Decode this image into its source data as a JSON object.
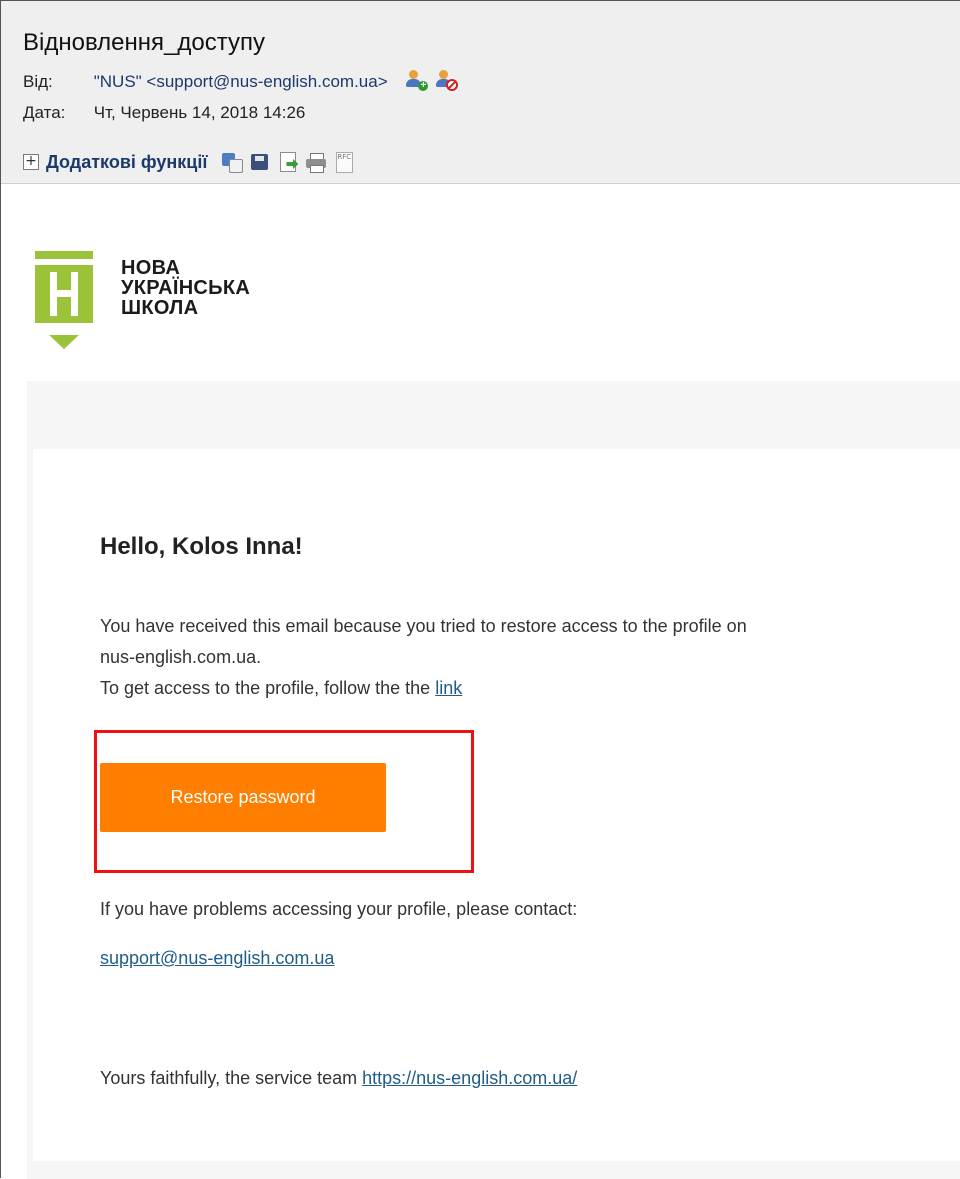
{
  "header": {
    "subject": "Відновлення_доступу",
    "from_label": "Від:",
    "from_value": "\"NUS\" <support@nus-english.com.ua>",
    "date_label": "Дата:",
    "date_value": "Чт, Червень 14, 2018 14:26",
    "contact_icons": [
      "add-contact-icon",
      "block-contact-icon"
    ],
    "more_functions_label": "Додаткові функції",
    "toolbar_icons": [
      "translate-icon",
      "save-icon",
      "export-icon",
      "print-icon",
      "rfc-icon"
    ],
    "rfc_text": "RFC"
  },
  "logo": {
    "line1": "НОВА",
    "line2": "УКРАЇНСЬКА",
    "line3": "ШКОЛА",
    "color": "#9ac33a"
  },
  "email": {
    "greeting": "Hello, Kolos Inna!",
    "para_line1": "You have received this email because you tried to restore access to the profile on",
    "para_line2": "nus-english.com.ua.",
    "para_line3_text": "To get access to the profile, follow the the ",
    "para_line3_link": "link",
    "button_label": "Restore password",
    "button_color": "#ff7e00",
    "highlight_color": "#ee1111",
    "problems_text": "If you have problems accessing your profile, please contact:",
    "support_email": "support@nus-english.com.ua",
    "signature_text": "Yours faithfully, the service team ",
    "signature_link": "https://nus-english.com.ua/"
  }
}
